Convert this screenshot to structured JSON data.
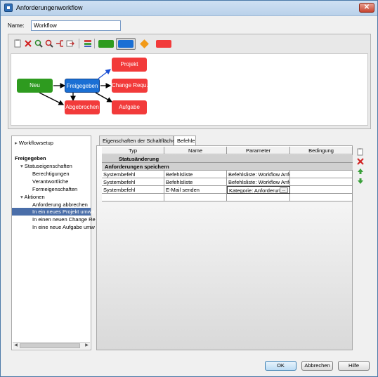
{
  "window": {
    "title": "Anforderungenworkflow",
    "close_glyph": "✕"
  },
  "name_field": {
    "label": "Name:",
    "value": "Workflow"
  },
  "toolbar": {
    "icons": [
      "new-icon",
      "delete-icon",
      "zoom-in-icon",
      "zoom-out-icon",
      "layout-icon",
      "export-icon",
      "grid-icon"
    ],
    "swatches": [
      {
        "color": "#2e9b1f"
      },
      {
        "color": "#1a6fd4",
        "selected": true
      },
      {
        "color": "#f29a18",
        "shape": "diamond"
      },
      {
        "color": "#f23a3a"
      }
    ]
  },
  "workflow": {
    "states": [
      {
        "id": "neu",
        "label": "Neu",
        "color": "#2e9b1f"
      },
      {
        "id": "freigegeben",
        "label": "Freigegeben",
        "color": "#1a6fd4"
      },
      {
        "id": "projekt",
        "label": "Projekt",
        "color": "#f23a3a"
      },
      {
        "id": "change",
        "label": "Change Requ...",
        "color": "#f23a3a"
      },
      {
        "id": "abgebrochen",
        "label": "Abgebrochen",
        "color": "#f23a3a"
      },
      {
        "id": "aufgabe",
        "label": "Aufgabe",
        "color": "#f23a3a"
      }
    ]
  },
  "tree": {
    "items": [
      {
        "label": "Workflowsetup",
        "prefix": "▸"
      },
      {
        "label": "Freigegeben",
        "prefix": "▾",
        "bold": true
      },
      {
        "label": "Statuseigenschaften",
        "prefix": "▾"
      },
      {
        "label": "Berechtigungen"
      },
      {
        "label": "Verantwortliche"
      },
      {
        "label": "Formeigenschaften"
      },
      {
        "label": "Aktionen",
        "prefix": "▾"
      },
      {
        "label": "Anforderung abbrechen"
      },
      {
        "label": "In ein neues Projekt umwa",
        "selected": true
      },
      {
        "label": "In einen neuen Change Re"
      },
      {
        "label": "In eine neue Aufgabe umw"
      }
    ]
  },
  "tabs": [
    {
      "label": "Eigenschaften der Schaltfläche"
    },
    {
      "label": "Befehle",
      "active": true
    }
  ],
  "table": {
    "columns": [
      "Typ",
      "Name",
      "Parameter",
      "Bedingung"
    ],
    "groups": [
      "Statusänderung",
      "Anforderungen speichern"
    ],
    "rows": [
      {
        "typ": "Systembefehl",
        "name": "Befehlsliste",
        "parameter": "Befehlsliste: Workflow Anfor...",
        "bedingung": ""
      },
      {
        "typ": "Systembefehl",
        "name": "Befehlsliste",
        "parameter": "Befehlsliste: Workflow Anfo...",
        "bedingung": ""
      },
      {
        "typ": "Systembefehl",
        "name": "E-Mail senden",
        "parameter": "Kategorie: Anforderun...",
        "bedingung": ""
      }
    ],
    "ellipsis": "..."
  },
  "side_actions": [
    "copy-icon",
    "delete-icon",
    "move-up-icon",
    "move-down-icon"
  ],
  "buttons": {
    "ok": "OK",
    "cancel": "Abbrechen",
    "help": "Hilfe"
  }
}
